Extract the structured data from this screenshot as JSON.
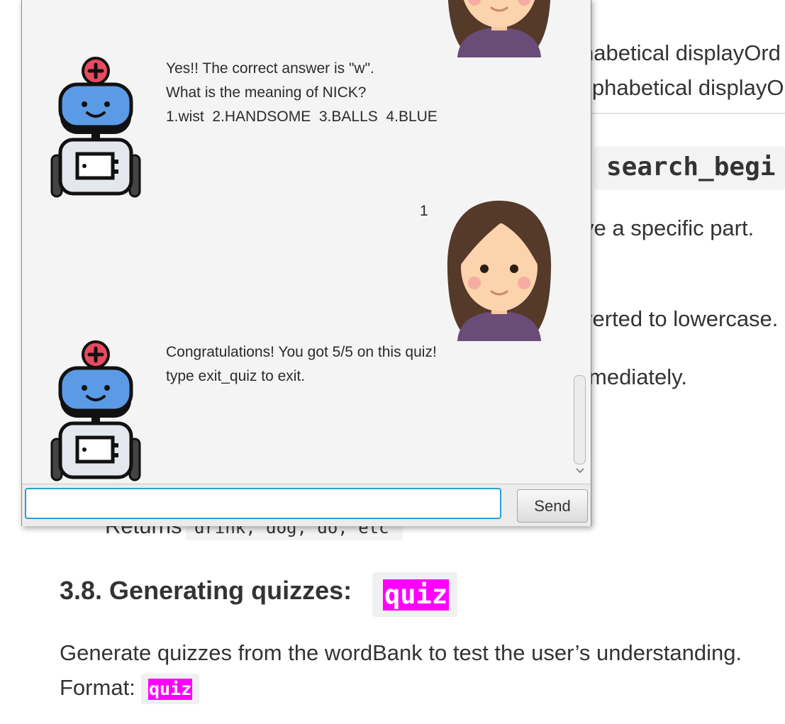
{
  "doc": {
    "line1": "habetical displayOrd",
    "line2": "lphabetical displayO",
    "code_heading": "search_begi",
    "line3": "ve a specific part.",
    "line4": "verted to lowercase.",
    "line5": "mediately.",
    "returns_label": "Returns",
    "returns_code": "drink, dog, do, etc",
    "heading": "3.8. Generating quizzes:",
    "heading_code": "quiz",
    "description": "Generate quizzes from the wordBank to test the user’s understanding.",
    "format_label": "Format:",
    "format_code": "quiz"
  },
  "chat": {
    "messages": [
      {
        "sender": "bot",
        "text": "Yes!! The correct answer is \"w\".\nWhat is the meaning of NICK?\n1.wist  2.HANDSOME  3.BALLS  4.BLUE"
      },
      {
        "sender": "user",
        "text": "1"
      },
      {
        "sender": "bot",
        "text": "Congratulations! You got 5/5 on this quiz!\ntype exit_quiz to exit."
      }
    ],
    "input_value": "",
    "send_label": "Send"
  },
  "icons": {
    "bot_avatar": "robot-icon",
    "user_avatar": "girl-avatar-icon",
    "scroll_down": "chevron-down-icon"
  },
  "colors": {
    "code_highlight": "#ff00ff",
    "input_focus": "#2a9fd6",
    "robot_head": "#5b9be6",
    "robot_badge": "#e84a5f"
  }
}
